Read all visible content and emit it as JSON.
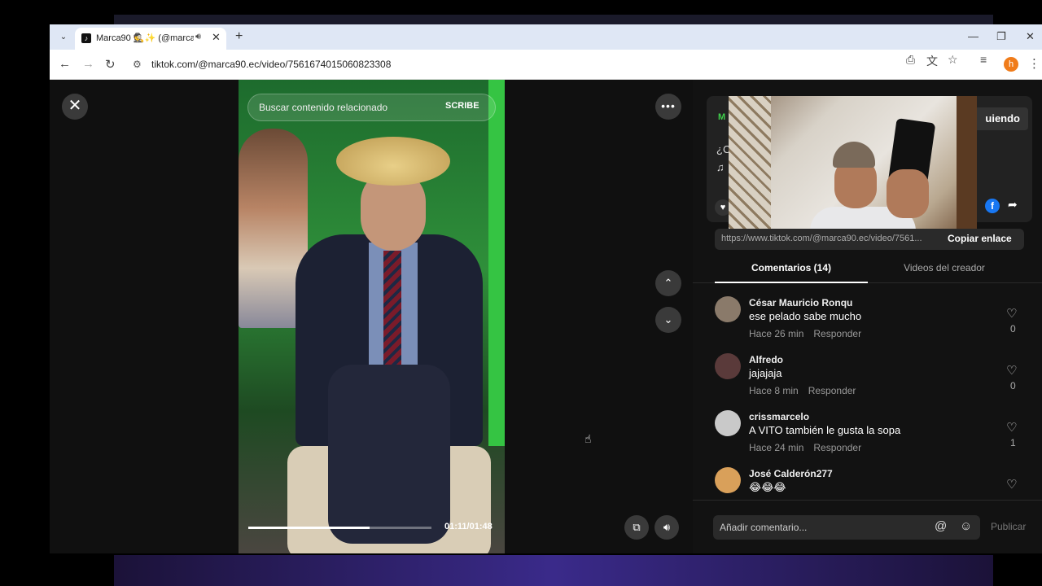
{
  "browser": {
    "tab_title": "Marca90 🕵️✨ (@marca90 ...",
    "tab_favicon": "tiktok-icon",
    "url": "tiktok.com/@marca90.ec/video/7561674015060823308"
  },
  "video": {
    "search_placeholder": "Buscar contenido relacionado",
    "brand_text": "SCRIBE",
    "time": "01:11/01:48",
    "progress": 0.66
  },
  "sidebar": {
    "info_green_text": "M",
    "info_line1": "¿C",
    "info_line2": "♫",
    "following_label": "uiendo",
    "link_url": "https://www.tiktok.com/@marca90.ec/video/7561...",
    "copy_link_label": "Copiar enlace",
    "tab_comments": "Comentarios (14)",
    "tab_videos": "Videos del creador",
    "comments": [
      {
        "name": "César Mauricio Ronqu",
        "text": "ese pelado sabe mucho",
        "time": "Hace 26 min",
        "reply": "Responder",
        "likes": "0",
        "avatar_color": "#8a7a6a"
      },
      {
        "name": "Alfredo",
        "text": "jajajaja",
        "time": "Hace 8 min",
        "reply": "Responder",
        "likes": "0",
        "avatar_color": "#5a3a3a"
      },
      {
        "name": "crissmarcelo",
        "text": "A VITO también le gusta la sopa",
        "time": "Hace 24 min",
        "reply": "Responder",
        "likes": "1",
        "avatar_color": "#c9c9c9"
      },
      {
        "name": "José Calderón277",
        "text": "😂😂😂",
        "time": "",
        "reply": "",
        "likes": "",
        "avatar_color": "#d9a05a"
      }
    ],
    "comment_placeholder": "Añadir comentario...",
    "publish_label": "Publicar"
  }
}
